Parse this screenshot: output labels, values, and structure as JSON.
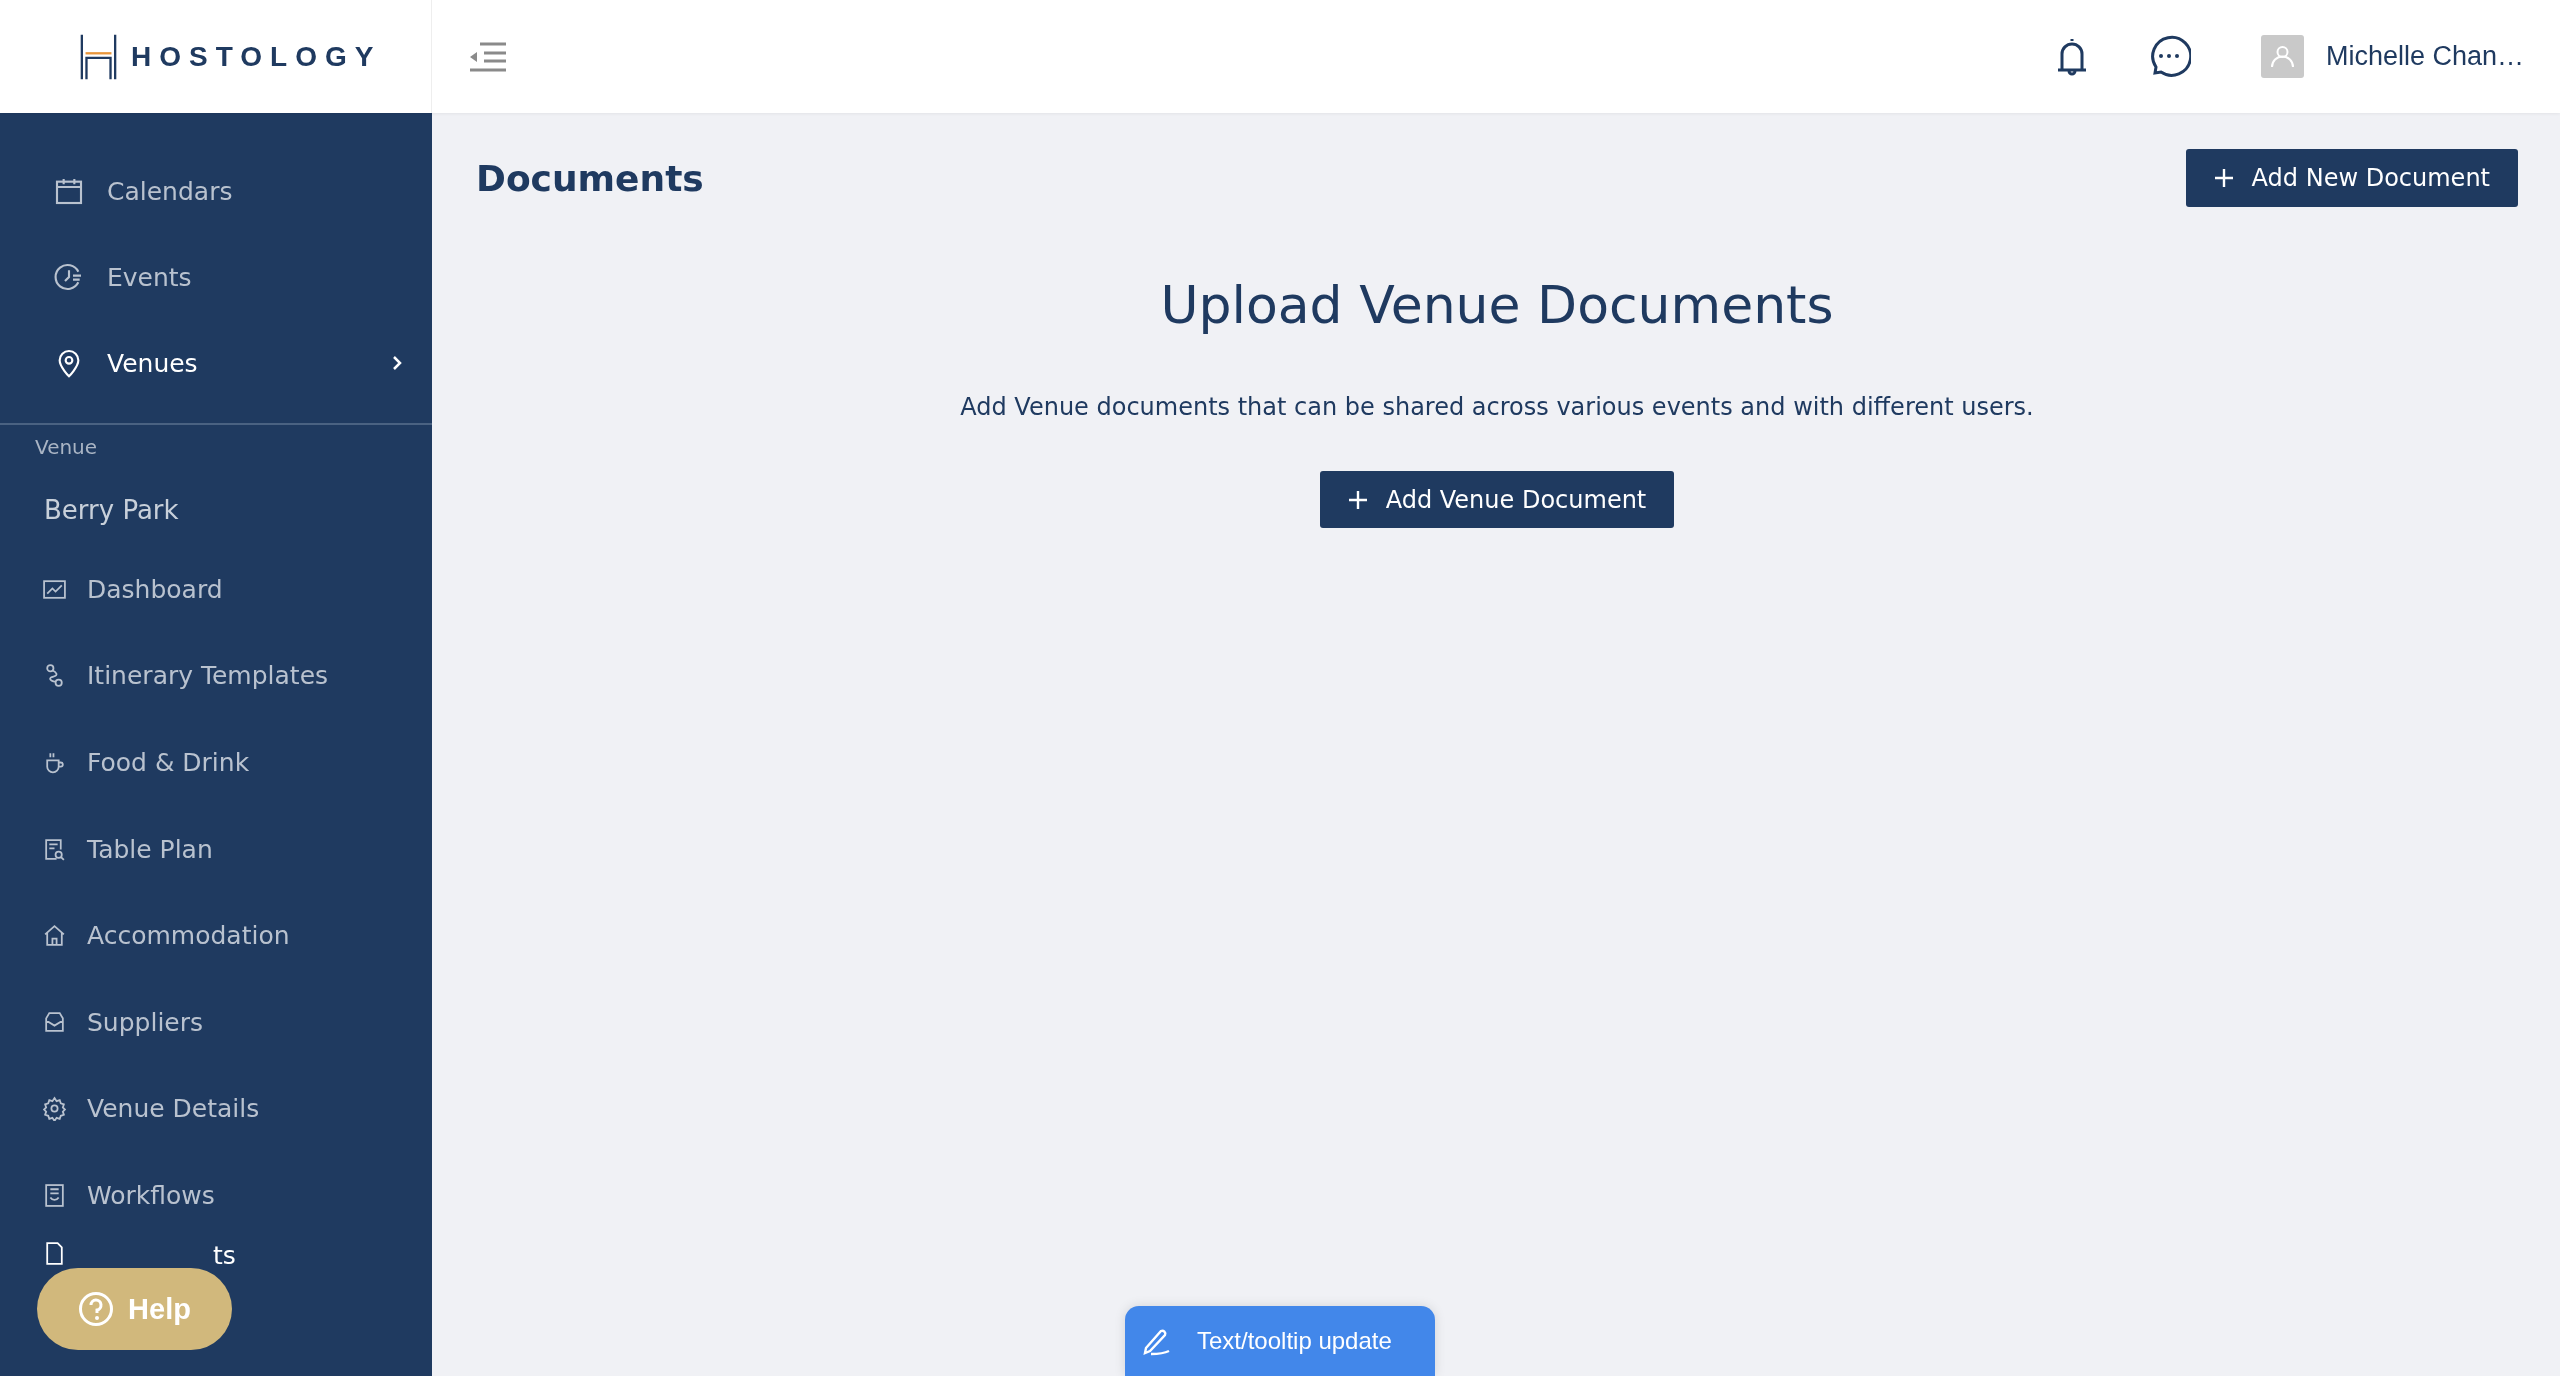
{
  "header": {
    "logo": "HOSTOLOGY",
    "user_name": "Michelle Chan…"
  },
  "sidebar": {
    "nav_items": [
      {
        "label": "Calendars",
        "selected": false
      },
      {
        "label": "Events",
        "selected": false
      },
      {
        "label": "Venues",
        "selected": true
      }
    ],
    "section_label": "Venue",
    "venue_name": "Berry Park",
    "sub_items": [
      {
        "label": "Dashboard",
        "selected": false
      },
      {
        "label": "Itinerary Templates",
        "selected": false
      },
      {
        "label": "Food & Drink",
        "selected": false
      },
      {
        "label": "Table Plan",
        "selected": false
      },
      {
        "label": "Accommodation",
        "selected": false
      },
      {
        "label": "Suppliers",
        "selected": false
      },
      {
        "label": "Venue Details",
        "selected": false
      },
      {
        "label": "Workflows",
        "selected": false
      },
      {
        "label": "ts",
        "selected": true
      }
    ]
  },
  "page": {
    "title": "Documents",
    "add_button": "Add New Document",
    "heading": "Upload Venue Documents",
    "description": "Add Venue documents that can be shared across various events and with different users.",
    "venue_button": "Add Venue Document"
  },
  "help_button": "Help",
  "update_button": "Text/tooltip update"
}
